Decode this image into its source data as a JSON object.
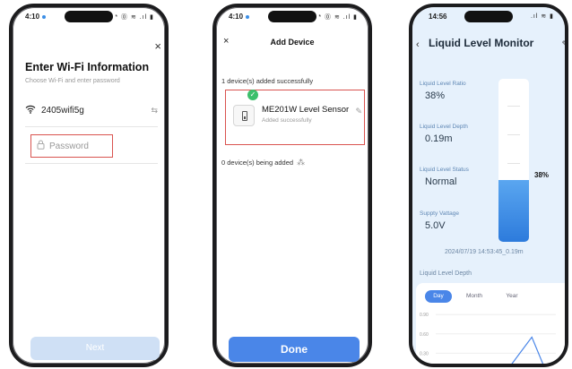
{
  "phone1": {
    "status": {
      "time": "4:10",
      "sys": "* ⓪ ≋ .ıl ▮"
    },
    "close_glyph": "×",
    "title": "Enter Wi-Fi Information",
    "subtitle": "Choose Wi-Fi and enter password",
    "wifi": {
      "icon_name": "wifi-icon",
      "icon": "📶",
      "ssid": "2405wifi5g",
      "swap_glyph": "⇆"
    },
    "password": {
      "icon_name": "lock-icon",
      "icon": "🔒",
      "placeholder": "Password",
      "value": ""
    },
    "next_label": "Next"
  },
  "phone2": {
    "status": {
      "time": "4:10",
      "sys": "* ⓪ ≋ .ıl ▮"
    },
    "close_glyph": "×",
    "title": "Add Device",
    "added_count": "1 device(s) added successfully",
    "device": {
      "check_glyph": "✓",
      "name": "ME201W Level Sensor",
      "status": "Added successfully",
      "edit_glyph": "✎"
    },
    "adding_count": "0 device(s) being added",
    "spinner_glyph": "⁂",
    "done_label": "Done"
  },
  "phone3": {
    "status": {
      "time": "14:56",
      "sys": ".ıl ≋ ▮"
    },
    "back_glyph": "‹",
    "title": "Liquid Level Monitor",
    "edit_glyph": "✎",
    "metrics": [
      {
        "label": "Liquid Level Ratio",
        "value": "38%"
      },
      {
        "label": "Liquid Level Depth",
        "value": "0.19m"
      },
      {
        "label": "Liquid Level Status",
        "value": "Normal"
      },
      {
        "label": "Suppty Vattage",
        "value": "5.0V"
      }
    ],
    "tank": {
      "level": 0.38,
      "label": "38%"
    },
    "timestamp": "2024/07/19 14:53:45_0.19m",
    "section_title": "Liquid Level Depth",
    "tabs": [
      "Day",
      "Month",
      "Year"
    ],
    "active_tab": "Day",
    "colors": {
      "accent": "#4a86e8",
      "fill": "#2d7bdc",
      "background": "#e6f1fc"
    },
    "chart_data": {
      "type": "line",
      "yticks": [
        "0.90",
        "0.60",
        "0.30"
      ],
      "ylim": [
        0,
        1.0
      ],
      "x": [
        0,
        1,
        2,
        3,
        4,
        5,
        6,
        7,
        8,
        9,
        10
      ],
      "values": [
        0.0,
        0.0,
        0.0,
        0.0,
        0.0,
        0.01,
        0.05,
        0.3,
        0.55,
        0.1,
        0.0
      ]
    }
  }
}
